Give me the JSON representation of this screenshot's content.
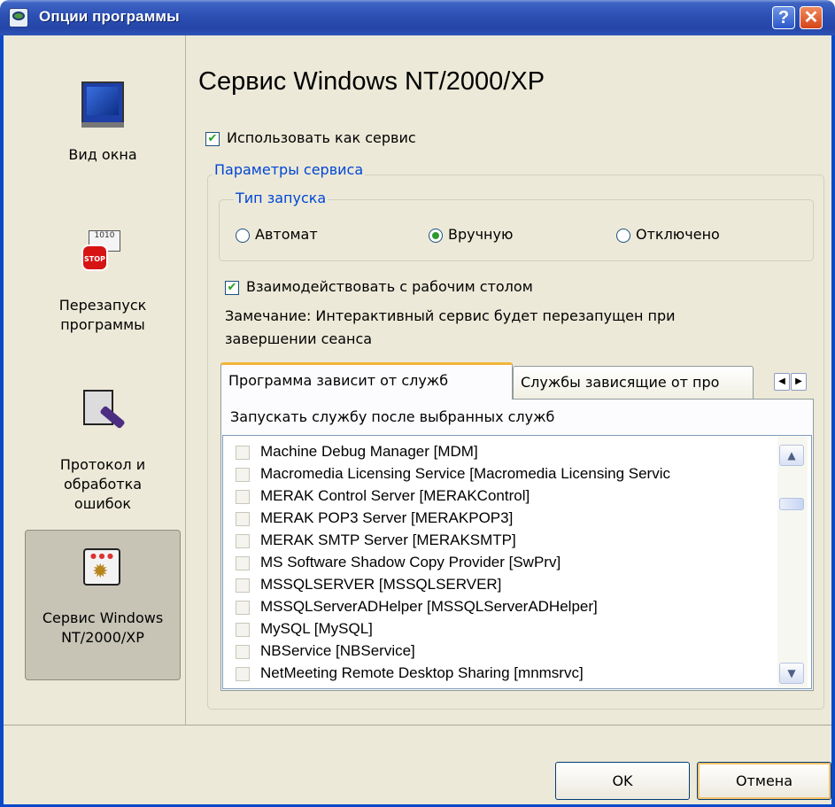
{
  "window": {
    "title": "Опции программы",
    "help_label": "?",
    "close_label": "✕"
  },
  "nav": {
    "items": [
      {
        "label": "Вид окна",
        "icon": "monitor-icon",
        "selected": false
      },
      {
        "label": "Перезапуск\nпрограммы",
        "icon": "stop-sign-icon",
        "selected": false
      },
      {
        "label": "Протокол и\nобработка\nошибок",
        "icon": "pen-log-icon",
        "selected": false
      },
      {
        "label": "Сервис Windows\nNT/2000/XP",
        "icon": "service-gear-icon",
        "selected": true
      }
    ]
  },
  "content": {
    "title": "Сервис Windows NT/2000/XP",
    "use_as_service": {
      "label": "Использовать как сервис",
      "checked": true
    },
    "service_params": {
      "title": "Параметры сервиса",
      "startup_type": {
        "title": "Тип запуска",
        "options": [
          {
            "label": "Автомат",
            "checked": false
          },
          {
            "label": "Вручную",
            "checked": true
          },
          {
            "label": "Отключено",
            "checked": false
          }
        ]
      },
      "interact_desktop": {
        "label": "Взаимодействовать с рабочим столом",
        "checked": true
      },
      "note_line1": "Замечание: Интерактивный сервис будет перезапущен при",
      "note_line2": "завершении сеанса",
      "tabs": [
        {
          "label": "Программа зависит от служб",
          "active": true
        },
        {
          "label": "Службы зависящие от про",
          "active": false
        }
      ],
      "tab_scroll_left": "◀",
      "tab_scroll_right": "▶",
      "panel_caption": "Запускать службу после выбранных служб",
      "services": [
        "Machine Debug Manager [MDM]",
        "Macromedia Licensing Service [Macromedia Licensing Servic",
        "MERAK Control Server [MERAKControl]",
        "MERAK POP3 Server [MERAKPOP3]",
        "MERAK SMTP Server [MERAKSMTP]",
        "MS Software Shadow Copy Provider [SwPrv]",
        "MSSQLSERVER [MSSQLSERVER]",
        "MSSQLServerADHelper [MSSQLServerADHelper]",
        "MySQL [MySQL]",
        "NBService [NBService]",
        "NetMeeting Remote Desktop Sharing [mnmsrvc]"
      ],
      "scroll_up": "▲",
      "scroll_down": "▼"
    }
  },
  "buttons": {
    "ok": "OK",
    "cancel": "Отмена"
  },
  "colors": {
    "titlebar": "#2546a8",
    "accent_blue": "#0046d5",
    "check_green": "#21a121",
    "tab_highlight": "#f4b53a"
  }
}
